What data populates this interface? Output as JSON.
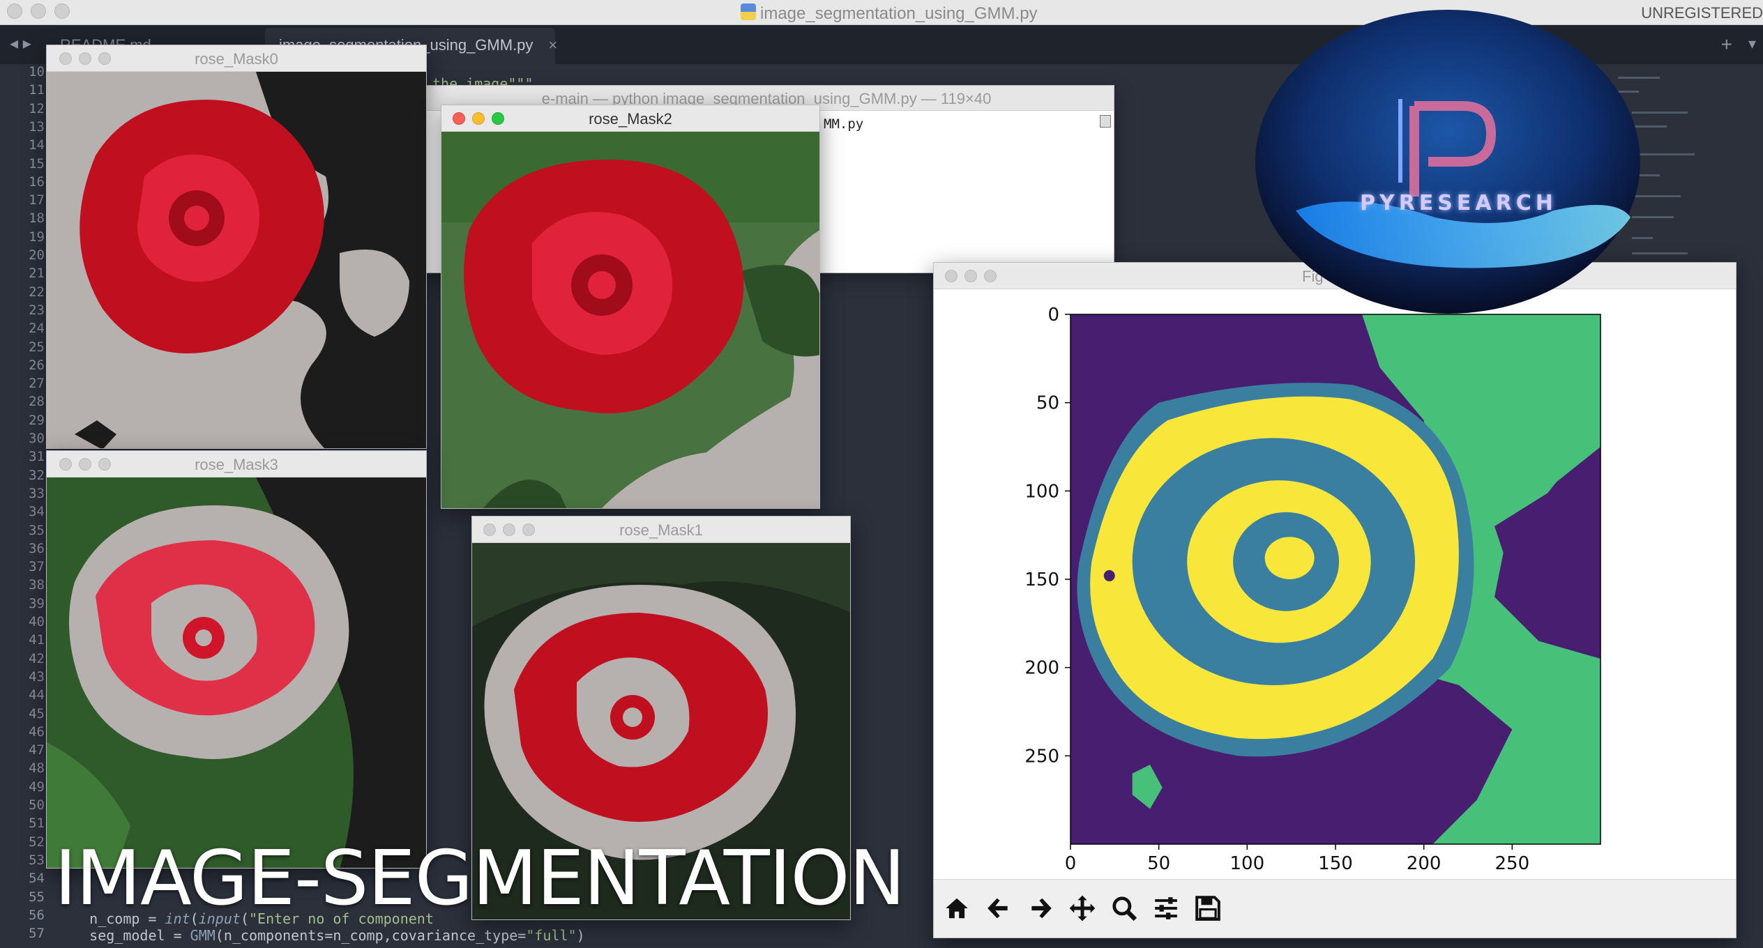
{
  "editor": {
    "title": "image_segmentation_using_GMM.py",
    "license_label": "UNREGISTERED",
    "tabs": [
      {
        "label": "README.md",
        "active": false
      },
      {
        "label": "image_segmentation_using_GMM.py",
        "active": true
      }
    ],
    "tab_close": "×",
    "tab_plus": "+",
    "tab_menu": "▾",
    "nav_arrows": "◂ ▸",
    "gutter_numbers": [
      "10",
      "11",
      "12",
      "13",
      "14",
      "15",
      "16",
      "17",
      "18",
      "19",
      "20",
      "21",
      "22",
      "23",
      "24",
      "25",
      "26",
      "27",
      "28",
      "29",
      "30",
      "31",
      "32",
      "33",
      "34",
      "35",
      "36",
      "37",
      "38",
      "39",
      "40",
      "41",
      "42",
      "43",
      "44",
      "45",
      "46",
      "47",
      "48",
      "49",
      "50",
      "51",
      "52",
      "53",
      "54",
      "55",
      "56",
      "57"
    ],
    "code_fragment": "the image\"\"\"",
    "code_lines": [
      {
        "n": "54",
        "indent": "    ",
        "parts": []
      },
      {
        "n": "55",
        "indent": "    ",
        "var": "n_comp = ",
        "call": "int",
        "open": "(",
        "call2": "input",
        "str": "\"Enter no of component",
        "close": ""
      },
      {
        "n": "56",
        "indent": "    ",
        "var": "seg_model = ",
        "call": "GMM",
        "args": "(n_components=n_comp,covariance_type=",
        "str": "\"full\"",
        "close": ")"
      }
    ]
  },
  "windows": {
    "mask0": {
      "title": "rose_Mask0"
    },
    "mask1": {
      "title": "rose_Mask1"
    },
    "mask2": {
      "title": "rose_Mask2"
    },
    "mask3": {
      "title": "rose_Mask3"
    }
  },
  "terminal": {
    "title": "e-main — python image_segmentation_using_GMM.py — 119×40",
    "line": "e-main — python image_segmentation_using_GMM.py",
    "line_tail": "MM.py"
  },
  "figure": {
    "title": "Fig",
    "toolbar": [
      "home-icon",
      "back-arrow-icon",
      "forward-arrow-icon",
      "pan-icon",
      "zoom-icon",
      "configure-subplots-icon",
      "save-icon"
    ]
  },
  "chart_data": {
    "type": "heatmap",
    "title": "",
    "xlabel": "",
    "ylabel": "",
    "xlim": [
      0,
      300
    ],
    "ylim": [
      300,
      0
    ],
    "x_ticks": [
      0,
      50,
      100,
      150,
      200,
      250
    ],
    "y_ticks": [
      0,
      50,
      100,
      150,
      200,
      250
    ],
    "colormap": [
      "#481f70",
      "#3b7fa0",
      "#47c17a",
      "#f8e73a"
    ],
    "segments": [
      {
        "label": "0",
        "color": "#481f70"
      },
      {
        "label": "1",
        "color": "#3b7fa0"
      },
      {
        "label": "2",
        "color": "#47c17a"
      },
      {
        "label": "3",
        "color": "#f8e73a"
      }
    ]
  },
  "overlay": {
    "headline": "IMAGE-SEGMENTATION",
    "logo_text": "PYRESEARCH"
  },
  "colors": {
    "editor_bg": "#2b303b",
    "rose_red": "#d0142a",
    "mask_gray": "#b6b0ae",
    "leaf_green": "#2f5a2a"
  }
}
